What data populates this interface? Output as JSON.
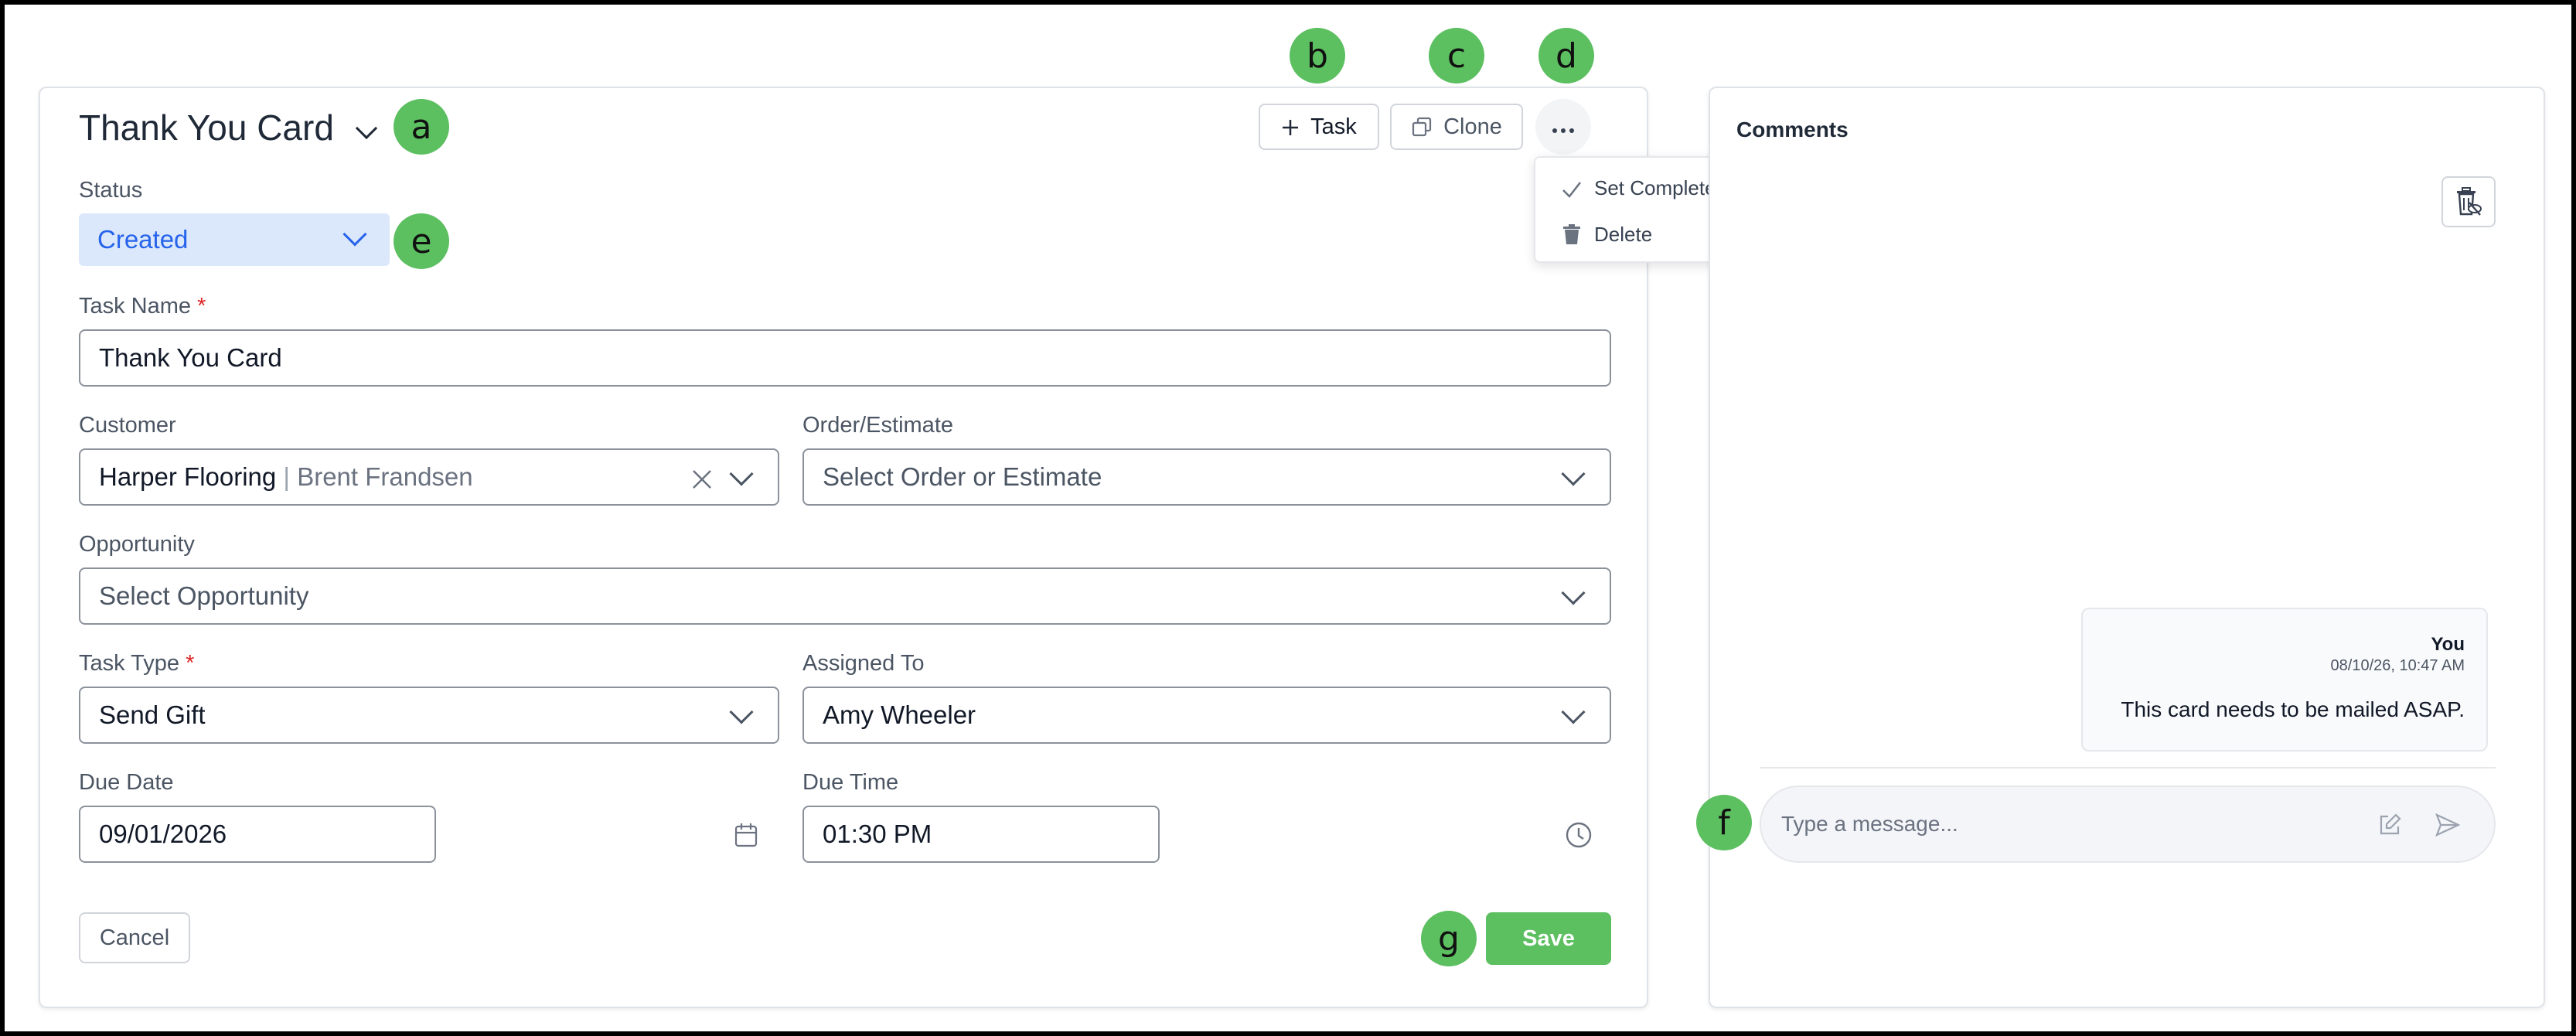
{
  "header": {
    "title": "Thank You Card",
    "task_button_label": "Task",
    "clone_button_label": "Clone"
  },
  "menu": {
    "items": [
      {
        "label": "Set Completed",
        "icon": "check-icon"
      },
      {
        "label": "Delete",
        "icon": "trash-icon"
      }
    ]
  },
  "form": {
    "status_label": "Status",
    "status_value": "Created",
    "task_name_label": "Task Name",
    "required_mark": "*",
    "task_name_value": "Thank You Card",
    "customer_label": "Customer",
    "customer_name": "Harper Flooring",
    "customer_separator": " | ",
    "customer_contact": "Brent Frandsen",
    "order_label": "Order/Estimate",
    "order_placeholder": "Select Order or Estimate",
    "opportunity_label": "Opportunity",
    "opportunity_placeholder": "Select Opportunity",
    "task_type_label": "Task Type",
    "task_type_value": "Send Gift",
    "assigned_label": "Assigned To",
    "assigned_value": "Amy Wheeler",
    "due_date_label": "Due Date",
    "due_date_value": "09/01/2026",
    "due_time_label": "Due Time",
    "due_time_value": "01:30 PM",
    "cancel_label": "Cancel",
    "save_label": "Save"
  },
  "comments": {
    "title": "Comments",
    "messages": [
      {
        "author": "You",
        "timestamp": "08/10/26, 10:47 AM",
        "text": "This card needs to be mailed ASAP."
      }
    ],
    "input_placeholder": "Type a message..."
  },
  "annotations": [
    "a",
    "b",
    "c",
    "d",
    "e",
    "f",
    "g"
  ],
  "colors": {
    "accent_green": "#5cbf60",
    "status_bg": "#dbe7fb",
    "status_text": "#2563eb",
    "required": "#dc2626"
  }
}
